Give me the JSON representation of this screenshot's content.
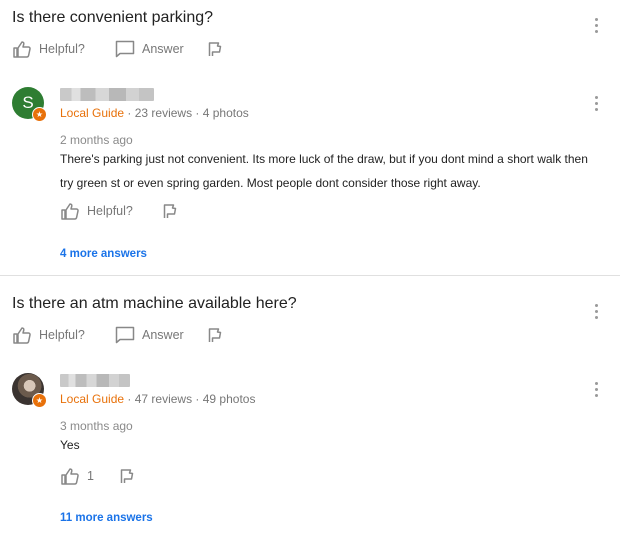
{
  "questions": [
    {
      "title": "Is there convenient parking?",
      "actions": {
        "helpful_label": "Helpful?",
        "answer_label": "Answer"
      },
      "answer": {
        "avatar_letter": "S",
        "local_guide_label": "Local Guide",
        "stats": "· 23 reviews · 4 photos",
        "date": "2 months ago",
        "text": "There's parking just not convenient. Its more luck of the draw, but if you dont mind a short walk then try green st or even spring garden. Most people dont consider those right away.",
        "helpful_label": "Helpful?"
      },
      "more_answers": "4 more answers"
    },
    {
      "title": "Is there an atm machine available here?",
      "actions": {
        "helpful_label": "Helpful?",
        "answer_label": "Answer"
      },
      "answer": {
        "local_guide_label": "Local Guide",
        "stats": "· 47 reviews · 49 photos",
        "date": "3 months ago",
        "text": "Yes",
        "helpful_count": "1"
      },
      "more_answers": "11 more answers"
    }
  ],
  "colors": {
    "local_guide": "#e8710a",
    "link": "#1a73e8",
    "avatar_green": "#2e7d32"
  },
  "icons": [
    "thumbs-up-icon",
    "answer-bubble-icon",
    "flag-icon",
    "more-vert-icon",
    "local-guide-badge-icon"
  ]
}
